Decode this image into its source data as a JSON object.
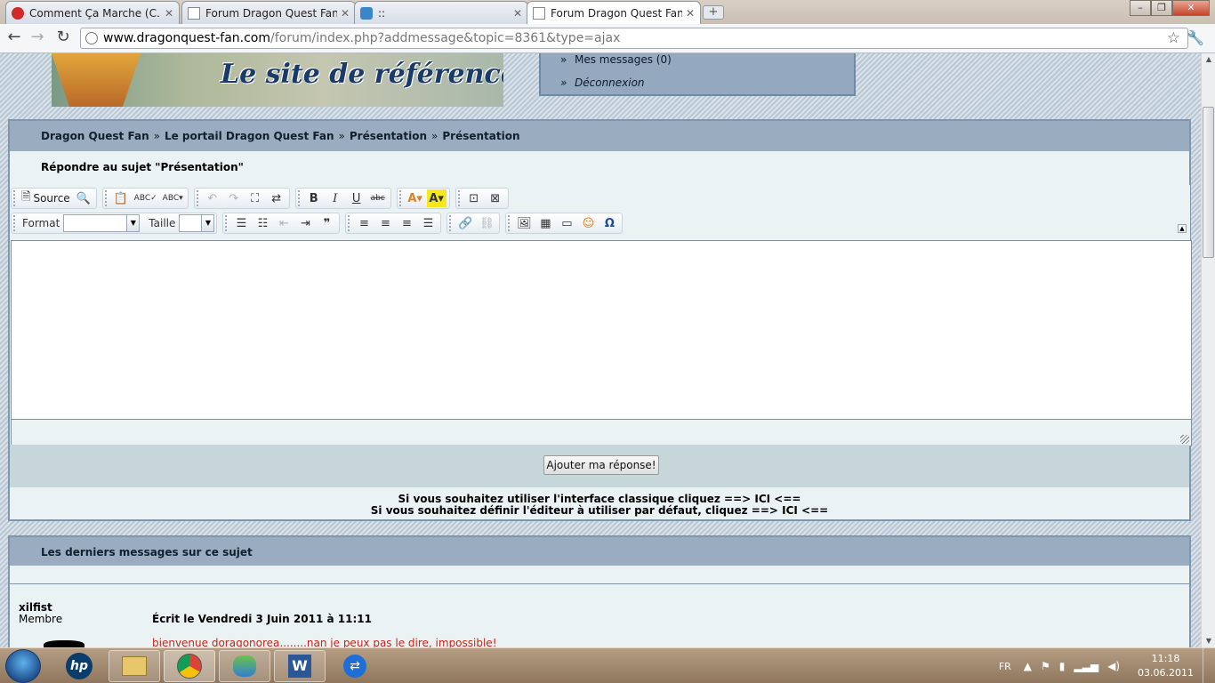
{
  "browser": {
    "tabs": [
      {
        "title": "Comment Ça Marche (C…",
        "favicon_color": "#d02a2a"
      },
      {
        "title": "Forum Dragon Quest Fan…",
        "favicon_color": "#8a8a8a"
      },
      {
        "title": "::",
        "favicon_color": "#3a86c8"
      },
      {
        "title": "Forum Dragon Quest Fan",
        "favicon_color": "#8a8a8a",
        "active": true
      }
    ],
    "url_host": "www.dragonquest-fan.com",
    "url_path": "/forum/index.php?addmessage&topic=8361&type=ajax"
  },
  "header": {
    "slogan": "Le site de référence",
    "user_menu": [
      "Mes messages (0)",
      "Déconnexion"
    ]
  },
  "breadcrumb": [
    "Dragon Quest Fan",
    "Le portail Dragon Quest Fan",
    "Présentation",
    "Présentation"
  ],
  "reply": {
    "title": "Répondre au sujet \"Présentation\"",
    "source_label": "Source",
    "format_label": "Format",
    "size_label": "Taille",
    "submit_label": "Ajouter ma réponse!",
    "hint_classic": "Si vous souhaitez utiliser l'interface classique cliquez ==> ICI <==",
    "hint_default": "Si vous souhaitez définir l'éditeur à utiliser par défaut, cliquez ==> ICI <=="
  },
  "last_messages": {
    "title": "Les derniers messages sur ce sujet",
    "author": "xilfist",
    "role": "Membre",
    "header": "Écrit le Vendredi 3 Juin 2011 à 11:11",
    "text": "bienvenue doragonorea........nan je peux pas le dire, impossible!"
  },
  "taskbar": {
    "lang": "FR",
    "time": "11:18",
    "date": "03.06.2011"
  }
}
